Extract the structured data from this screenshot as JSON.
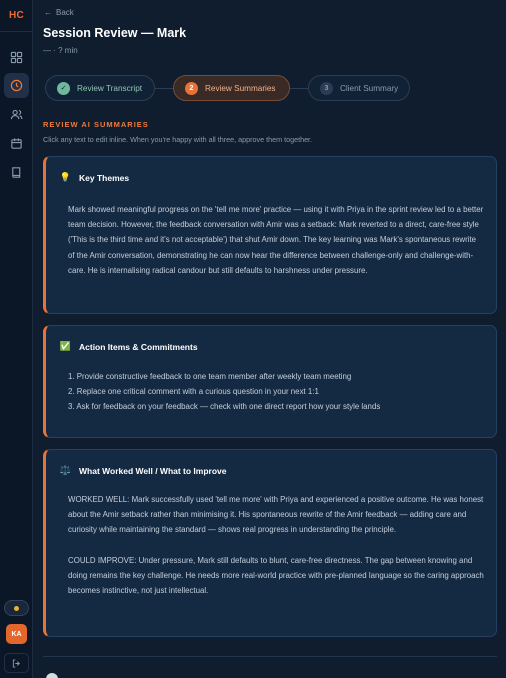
{
  "sidebar": {
    "logo": "HC",
    "avatar_initials": "KA"
  },
  "header": {
    "back_label": "Back",
    "title": "Session Review — Mark",
    "meta": "— · ? min"
  },
  "stepper": {
    "steps": [
      {
        "label": "Review Transcript",
        "num": "✓",
        "state": "done"
      },
      {
        "label": "Review Summaries",
        "num": "2",
        "state": "active"
      },
      {
        "label": "Client Summary",
        "num": "3",
        "state": "pending"
      }
    ]
  },
  "section": {
    "label": "REVIEW AI SUMMARIES",
    "hint": "Click any text to edit inline. When you're happy with all three, approve them together."
  },
  "cards": [
    {
      "icon": "lightbulb-icon",
      "icon_glyph": "💡",
      "title": "Key Themes",
      "paragraphs": [
        "Mark showed meaningful progress on the 'tell me more' practice — using it with Priya in the sprint review led to a better team decision. However, the feedback conversation with Amir was a setback: Mark reverted to a direct, care-free style ('This is the third time and it's not acceptable') that shut Amir down. The key learning was Mark's spontaneous rewrite of the Amir conversation, demonstrating he can now hear the difference between challenge-only and challenge-with-care. He is internalising radical candour but still defaults to harshness under pressure."
      ]
    },
    {
      "icon": "checkbox-icon",
      "icon_glyph": "✅",
      "title": "Action Items & Commitments",
      "items": [
        "1. Provide constructive feedback to one team member after weekly team meeting",
        "2. Replace one critical comment with a curious question in your next 1:1",
        "3. Ask for feedback on your feedback — check with one direct report how your style lands"
      ]
    },
    {
      "icon": "scales-icon",
      "icon_glyph": "⚖️",
      "title": "What Worked Well / What to Improve",
      "paragraphs": [
        "WORKED WELL: Mark successfully used 'tell me more' with Priya and experienced a positive outcome. He was honest about the Amir setback rather than minimising it. His spontaneous rewrite of the Amir feedback — adding care and curiosity while maintaining the standard — shows real progress in understanding the principle.",
        "COULD IMPROVE: Under pressure, Mark still defaults to blunt, care-free directness. The gap between knowing and doing remains the key challenge. He needs more real-world practice with pre-planned language so the caring approach becomes instinctive, not just intellectual."
      ]
    }
  ],
  "colors": {
    "background": "#0f1d2e",
    "accent": "#e8733a",
    "success": "#6fb89b"
  }
}
